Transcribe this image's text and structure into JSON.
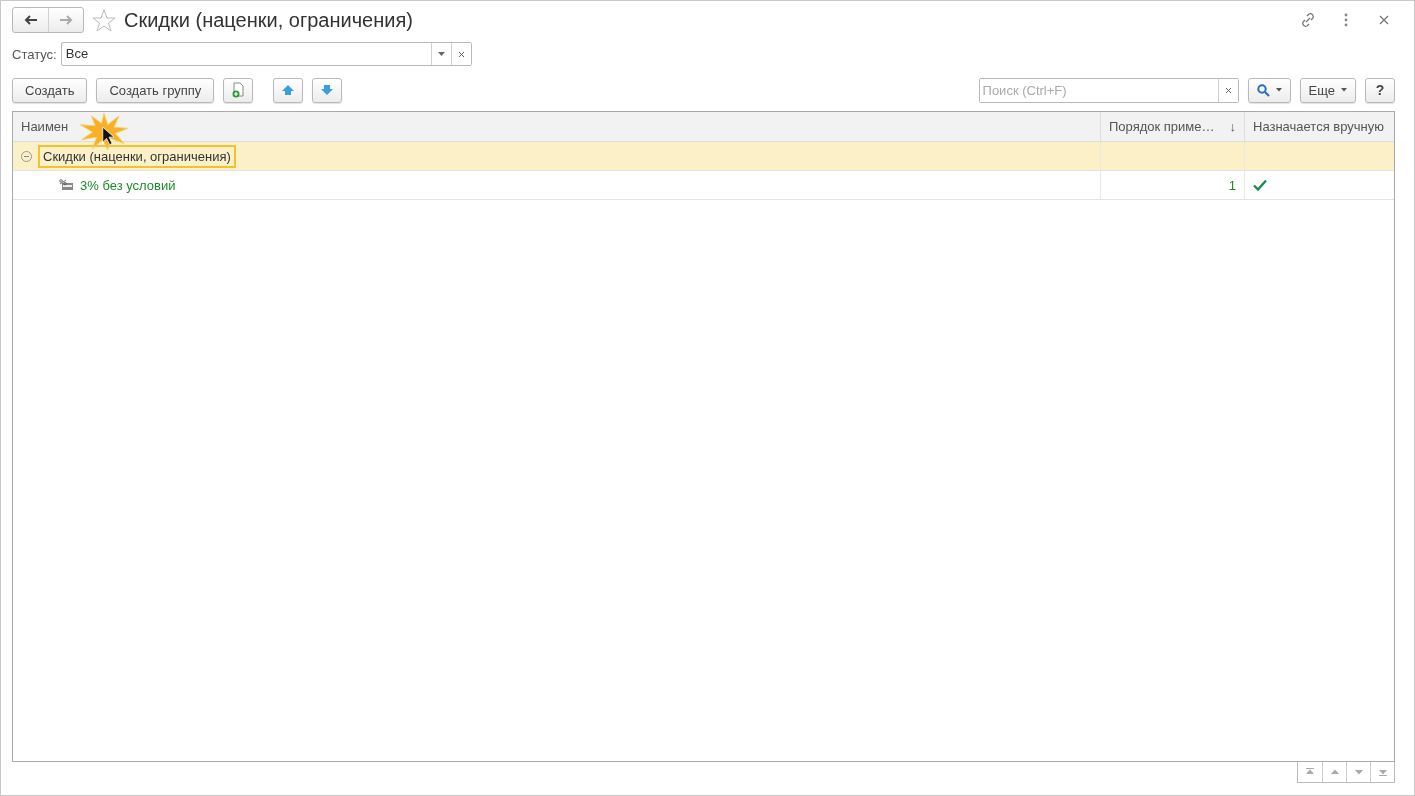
{
  "window": {
    "title": "Скидки (наценки, ограничения)",
    "favorite": false
  },
  "filter": {
    "label": "Статус:",
    "value": "Все"
  },
  "toolbar": {
    "buttons": [
      "Создать",
      "Создать группу"
    ],
    "search": {
      "placeholder": "Поиск (Ctrl+F)"
    },
    "more": "Еще",
    "help": "?"
  },
  "table": {
    "columns": [
      {
        "label": "Наимен"
      },
      {
        "label": "Порядок приме…",
        "sort_indicator": "↓"
      },
      {
        "label": "Назначается вручную"
      }
    ],
    "rows": [
      {
        "kind": "group",
        "name": "Скидки (наценки, ограничения)",
        "expanded": true,
        "selected": true,
        "children": [
          {
            "kind": "item",
            "name": "3% без условий",
            "order": "1",
            "manual": true,
            "selected": false
          }
        ]
      }
    ]
  }
}
